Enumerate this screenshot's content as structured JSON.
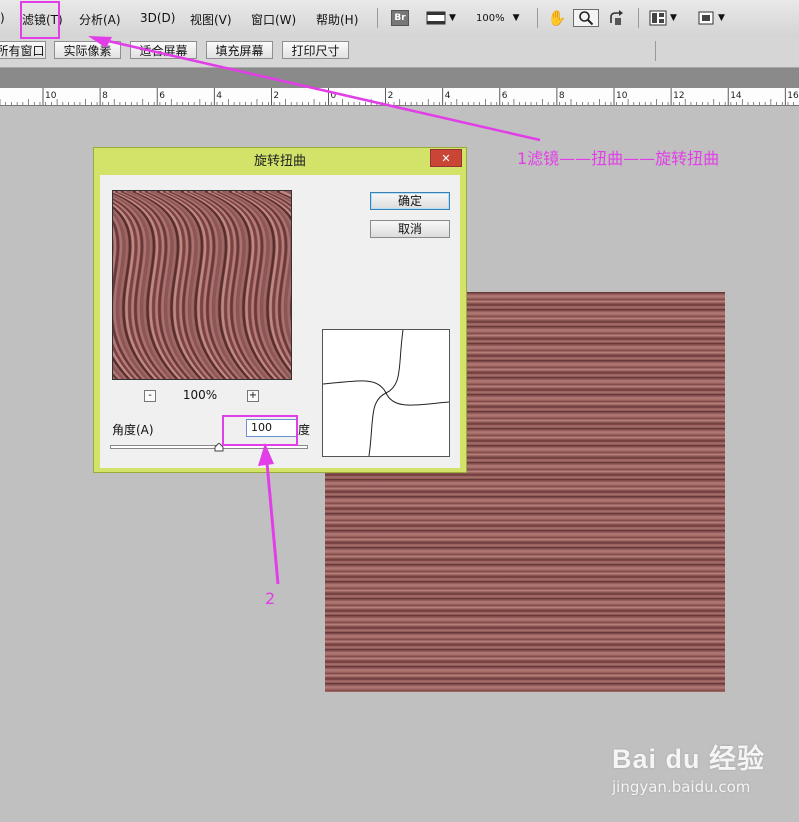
{
  "menubar": {
    "items": [
      ")",
      "滤镜(T)",
      "分析(A)",
      "3D(D)",
      "视图(V)",
      "窗口(W)",
      "帮助(H)"
    ],
    "bridge_label": "Br",
    "zoom_value": "100%"
  },
  "options_bar": {
    "buttons": [
      "所有窗口",
      "实际像素",
      "适合屏幕",
      "填充屏幕",
      "打印尺寸"
    ]
  },
  "ruler": {
    "labels": [
      "10",
      "8",
      "6",
      "4",
      "2",
      "0",
      "2",
      "4",
      "6",
      "8",
      "10",
      "12",
      "14",
      "16"
    ]
  },
  "dialog": {
    "title": "旋转扭曲",
    "close_label": "✕",
    "ok_label": "确定",
    "cancel_label": "取消",
    "zoom_minus": "-",
    "zoom_plus": "+",
    "zoom_value": "100%",
    "angle_label": "角度(A)",
    "angle_value": "100",
    "angle_unit": "度",
    "slider_level": 0.55
  },
  "annotations": {
    "step1": "1滤镜——扭曲——旋转扭曲",
    "step2": "2"
  },
  "watermark": {
    "brand": "Bai du 经验",
    "url": "jingyan.baidu.com"
  },
  "colors": {
    "annotation": "#e23ee8",
    "dialog_frame": "#d3e36a",
    "close_button": "#c94535",
    "texture": "#8c5656"
  },
  "icons": [
    "hand-icon",
    "zoom-tool-icon",
    "rotate-view-icon",
    "arrange-documents-icon",
    "screen-mode-icon",
    "camera-strip-icon"
  ]
}
